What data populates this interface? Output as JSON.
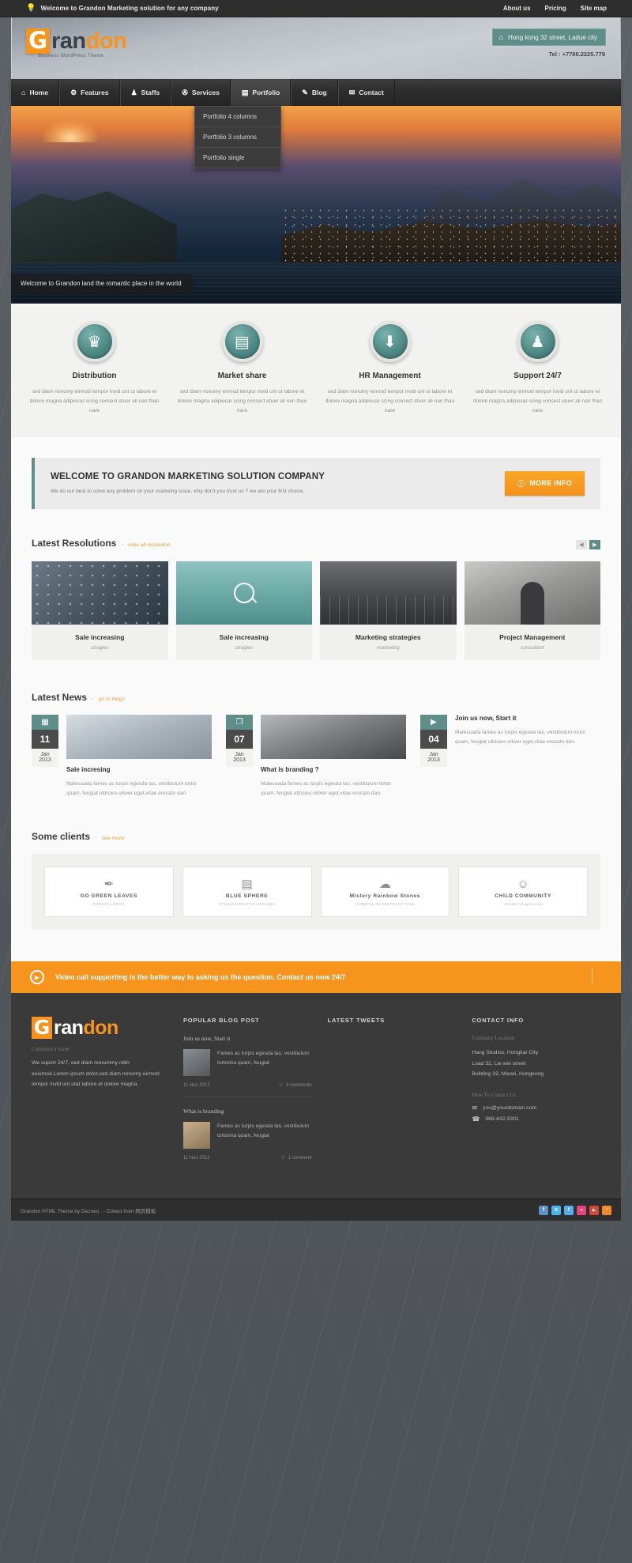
{
  "topbar": {
    "welcome": "Welcome to Grandon Marketing solution for any company",
    "bulb_icon": "lightbulb-icon",
    "links": [
      "About us",
      "Pricing",
      "Site map"
    ]
  },
  "header": {
    "logo_g": "G",
    "logo_dark": "ran",
    "logo_orange": "don",
    "tagline": "Business WordPress Theme",
    "address": "Hong kong 32 street, Ladue city",
    "address_icon": "home-icon",
    "tel": "Tel : +7780.2225.779"
  },
  "nav": {
    "items": [
      {
        "label": "Home",
        "icon": "home-icon",
        "glyph": "⌂"
      },
      {
        "label": "Features",
        "icon": "gear-icon",
        "glyph": "⚙"
      },
      {
        "label": "Staffs",
        "icon": "user-icon",
        "glyph": "♟"
      },
      {
        "label": "Services",
        "icon": "pin-icon",
        "glyph": "⚑"
      },
      {
        "label": "Portfolio",
        "icon": "briefcase-icon",
        "glyph": "▤"
      },
      {
        "label": "Blog",
        "icon": "pencil-icon",
        "glyph": "✎"
      },
      {
        "label": "Contact",
        "icon": "envelope-icon",
        "glyph": "✉"
      }
    ],
    "active": "Portfolio",
    "dropdown": [
      "Portfolio 4 columns",
      "Portfolio 3 columns",
      "Portfolio single"
    ]
  },
  "slider": {
    "caption": "Welcome to Grandon land the romantic place in the world"
  },
  "features": [
    {
      "title": "Distribution",
      "icon": "trophy-icon",
      "glyph": "♛",
      "desc": "sed diam nonumy eirmod tempor invid unt ut labore et dolore magna adipiocar scing consect etuer ali nan thao nare"
    },
    {
      "title": "Market share",
      "icon": "briefcase-icon",
      "glyph": "▤",
      "desc": "sed diam nonumy eirmod tempor invid unt ut labore et dolore magna adipiocar scing consect etuer ali nan thao nare"
    },
    {
      "title": "HR Management",
      "icon": "download-icon",
      "glyph": "⬇",
      "desc": "sed diam nonumy eirmod tempor invid unt ut labore et dolore magna adipiocar scing consect etuer ali nan thao nare"
    },
    {
      "title": "Support 24/7",
      "icon": "users-icon",
      "glyph": "♟",
      "desc": "sed diam nonumy eirmod tempor invid unt ut labore et dolore magna adipiocar scing consect etuer ali nan thao nare"
    }
  ],
  "welcome": {
    "heading": "WELCOME TO GRANDON MARKETING SOLUTION COMPANY",
    "text": "We do our best to solve any problem on your markeing issue, why don't you trust us ? we are your first choice.",
    "button": "MORE INFO",
    "button_icon": "info-icon"
  },
  "resolutions": {
    "title": "Latest Resolutions",
    "dash": "-",
    "link": "view all resolution",
    "prev_icon": "chevron-left-icon",
    "next_icon": "chevron-right-icon",
    "items": [
      {
        "title": "Sale increasing",
        "sub": "stragies"
      },
      {
        "title": "Sale increasing",
        "sub": "stragies"
      },
      {
        "title": "Marketing strategies",
        "sub": "marketing"
      },
      {
        "title": "Project Management",
        "sub": "consultant"
      }
    ]
  },
  "news": {
    "title": "Latest News",
    "dash": "-",
    "link": "go to blogs",
    "items": [
      {
        "day": "11",
        "month": "Jan",
        "year": "2013",
        "icon": "chart-icon",
        "glyph": "▦",
        "title": "Sale incresing",
        "text": "Malesuada fames ac turpis egesda tas, vestibulum tortor quam, feugiat ultricies orliver eget,vitae erocato dan."
      },
      {
        "day": "07",
        "month": "Jan",
        "year": "2013",
        "icon": "gallery-icon",
        "glyph": "❐",
        "title": "What is branding ?",
        "text": "Malesuada fames ac turpis egesda tas, vestibulum tortor quam, feugiat ultricies orliver eget,vitae erocato dan."
      },
      {
        "day": "04",
        "month": "Jan",
        "year": "2013",
        "icon": "video-icon",
        "glyph": "▶",
        "title": "Join us now, Start it",
        "text": "Malesuada fames ac turpis egesda tas, vestibulum tortor quam, feugiat ultricies orliver eget,vitae erocato dan."
      }
    ]
  },
  "clients": {
    "title": "Some clients",
    "dash": "-",
    "link": "see more",
    "items": [
      {
        "mark": "✒",
        "name": "GO GREEN LEAVES",
        "sub": "FOREST LOGOS"
      },
      {
        "mark": "▤",
        "name": "BLUE SPHERE",
        "sub": "STUDIO CREATIVE DESIGNS"
      },
      {
        "mark": "☁",
        "name": "Mistery Rainbow Stones",
        "sub": "CAREFUL 3D ABSTRACT ICON"
      },
      {
        "mark": "☺",
        "name": "CHILD COMMUNITY",
        "sub": "Abstract shapes icon"
      }
    ]
  },
  "cta": {
    "icon": "video-camera-icon",
    "text": "Video call supporting is the better way to asking us the question. Contact us now 24/7"
  },
  "footer": {
    "logo_g": "G",
    "logo_white": "ran",
    "logo_orange": "don",
    "company_label": "Company's name",
    "about": "We suport 24/7, sed diam nonummy nibh euismod.Lorem ipsum dolor,sed diam nonumy eirmod tempor invid unt utat labore et dolore magna.",
    "blog": {
      "heading": "POPULAR BLOG POST",
      "posts": [
        {
          "title": "Join us now, Start it",
          "text": "Fames ac turpis egesda tas, vestibulum tortorina quam, feugiat",
          "date": "11 Nov 2012",
          "comments": "3 comments",
          "comment_icon": "comment-icon",
          "avatar": "avatar-male"
        },
        {
          "title": "What is branding",
          "text": "Fames ac turpis egesda tas, vestibulum tortorina quam, feugiat",
          "date": "11 Nov 2012",
          "comments": "1 comment",
          "comment_icon": "comment-icon",
          "avatar": "avatar-female"
        }
      ]
    },
    "tweets": {
      "heading": "LATEST TWEETS"
    },
    "contact": {
      "heading": "CONTACT INFO",
      "location_label": "Company Location",
      "location_lines": [
        "Hang Studios, Hongkar City",
        "Load 32, Lie wei street",
        "Building 32, Maoei, Hongkong"
      ],
      "how_label": "How To Contact Us",
      "email": "you@yourdomain.com",
      "email_icon": "envelope-icon",
      "phone": "968-442-3301",
      "phone_icon": "phone-icon"
    }
  },
  "bottombar": {
    "copyright": "Grandon HTML Theme by Decneo . - Collect from 网页模板",
    "socials": [
      {
        "name": "facebook-icon",
        "glyph": "f",
        "color": "#5e92c9"
      },
      {
        "name": "skype-icon",
        "glyph": "s",
        "color": "#4ab5ea"
      },
      {
        "name": "twitter-icon",
        "glyph": "t",
        "color": "#55acee"
      },
      {
        "name": "flickr-icon",
        "glyph": "••",
        "color": "#e0457b"
      },
      {
        "name": "youtube-icon",
        "glyph": "▶",
        "color": "#d34836"
      },
      {
        "name": "rss-icon",
        "glyph": "◔",
        "color": "#f08b2c"
      }
    ]
  }
}
